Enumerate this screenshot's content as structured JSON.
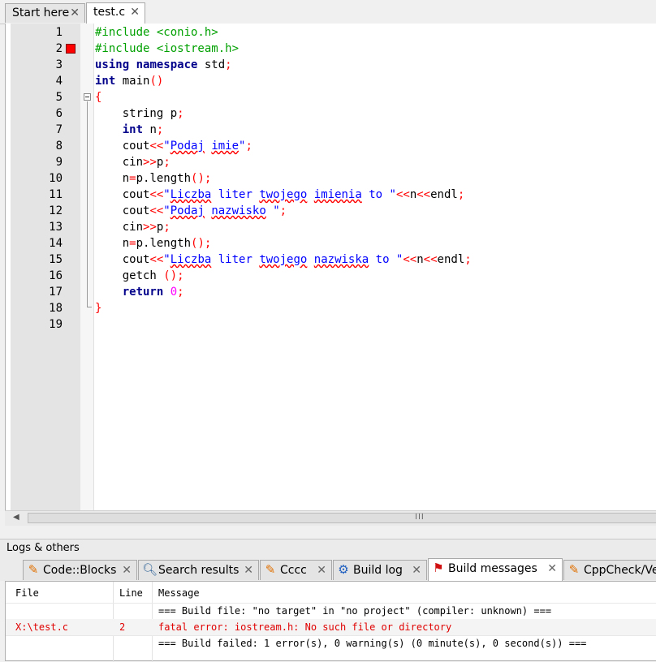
{
  "editor_tabs": [
    {
      "label": "Start here",
      "close": "✕"
    },
    {
      "label": "test.c",
      "close": "✕"
    }
  ],
  "code_lines": [
    {
      "num": "1"
    },
    {
      "num": "2"
    },
    {
      "num": "3"
    },
    {
      "num": "4"
    },
    {
      "num": "5"
    },
    {
      "num": "6"
    },
    {
      "num": "7"
    },
    {
      "num": "8"
    },
    {
      "num": "9"
    },
    {
      "num": "10"
    },
    {
      "num": "11"
    },
    {
      "num": "12"
    },
    {
      "num": "13"
    },
    {
      "num": "14"
    },
    {
      "num": "15"
    },
    {
      "num": "16"
    },
    {
      "num": "17"
    },
    {
      "num": "18"
    },
    {
      "num": "19"
    }
  ],
  "code": {
    "l1": "#include <conio.h>",
    "l2": "#include <iostream.h>",
    "l3_kw1": "using",
    "l3_kw2": "namespace",
    "l3_id": " std",
    "l3_op": ";",
    "l4_kw": "int",
    "l4_id": " main",
    "l4_op": "()",
    "l5_op": "{",
    "l6_id": "    string p",
    "l6_op": ";",
    "l7_indent": "    ",
    "l7_kw": "int",
    "l7_id": " n",
    "l7_op": ";",
    "l8_id": "    cout",
    "l8_op": "<<",
    "l8_q1": "\"",
    "l8_w1": "Podaj",
    "l8_sp": " ",
    "l8_w2": "imie",
    "l8_q2": "\"",
    "l8_end": ";",
    "l9_id": "    cin",
    "l9_op": ">>",
    "l9_id2": "p",
    "l9_end": ";",
    "l10_id": "    n",
    "l10_op": "=",
    "l10_id2": "p.length",
    "l10_paren": "()",
    "l10_end": ";",
    "l11_id": "    cout",
    "l11_op": "<<",
    "l11_q1": "\"",
    "l11_w1": "Liczba",
    "l11_s1": " liter ",
    "l11_w2": "twojego",
    "l11_s2": " ",
    "l11_w3": "imienia",
    "l11_s3": " to \"",
    "l11_op2": "<<",
    "l11_id2": "n",
    "l11_op3": "<<",
    "l11_id3": "endl",
    "l11_end": ";",
    "l12_id": "    cout",
    "l12_op": "<<",
    "l12_q1": "\"",
    "l12_w1": "Podaj",
    "l12_sp": " ",
    "l12_w2": "nazwisko",
    "l12_q2": " \"",
    "l12_end": ";",
    "l13_id": "    cin",
    "l13_op": ">>",
    "l13_id2": "p",
    "l13_end": ";",
    "l14_id": "    n",
    "l14_op": "=",
    "l14_id2": "p.length",
    "l14_paren": "()",
    "l14_end": ";",
    "l15_id": "    cout",
    "l15_op": "<<",
    "l15_q1": "\"",
    "l15_w1": "Liczba",
    "l15_s1": " liter ",
    "l15_w2": "twojego",
    "l15_s2": " ",
    "l15_w3": "nazwiska",
    "l15_s3": " to \"",
    "l15_op2": "<<",
    "l15_id2": "n",
    "l15_op3": "<<",
    "l15_id3": "endl",
    "l15_end": ";",
    "l16_id": "    getch ",
    "l16_op": "();",
    "l17_indent": "    ",
    "l17_kw": "return",
    "l17_num": " 0",
    "l17_op": ";",
    "l18_op": "}"
  },
  "scrollbar": {
    "grip": "III"
  },
  "logs": {
    "title": "Logs & others",
    "tabs": [
      {
        "label": "Code::Blocks",
        "icon": "page-pencil-icon",
        "close": "✕"
      },
      {
        "label": "Search results",
        "icon": "magnifier-icon",
        "close": "✕"
      },
      {
        "label": "Cccc",
        "icon": "page-pencil-icon",
        "close": "✕"
      },
      {
        "label": "Build log",
        "icon": "gear-icon",
        "close": "✕"
      },
      {
        "label": "Build messages",
        "icon": "pushpin-icon",
        "close": "✕"
      },
      {
        "label": "CppCheck/Ve",
        "icon": "page-pencil-icon",
        "close": ""
      }
    ],
    "columns": {
      "file": "File",
      "line": "Line",
      "message": "Message"
    },
    "rows": [
      {
        "file": "",
        "line": "",
        "message": "=== Build file: \"no target\" in \"no project\" (compiler: unknown) ===",
        "type": "info"
      },
      {
        "file": "X:\\test.c",
        "line": "2",
        "message": "fatal error: iostream.h: No such file or directory",
        "type": "error"
      },
      {
        "file": "",
        "line": "",
        "message": "=== Build failed: 1 error(s), 0 warning(s) (0 minute(s), 0 second(s)) ===",
        "type": "info"
      }
    ]
  },
  "colors": {
    "preprocessor": "#00a000",
    "keyword": "#00008b",
    "operator": "#ff0000",
    "string": "#0000ff",
    "number": "#ff00ff",
    "error_text": "#e00000",
    "breakpoint": "#ff0000"
  }
}
